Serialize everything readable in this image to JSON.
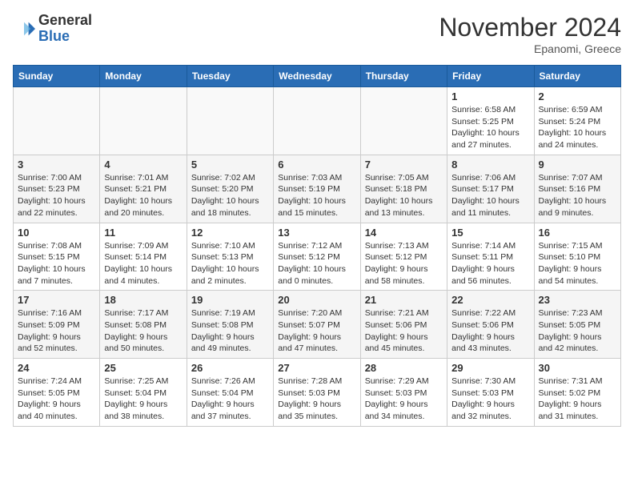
{
  "header": {
    "logo_line1": "General",
    "logo_line2": "Blue",
    "month": "November 2024",
    "location": "Epanomi, Greece"
  },
  "days_of_week": [
    "Sunday",
    "Monday",
    "Tuesday",
    "Wednesday",
    "Thursday",
    "Friday",
    "Saturday"
  ],
  "weeks": [
    [
      {
        "day": "",
        "info": ""
      },
      {
        "day": "",
        "info": ""
      },
      {
        "day": "",
        "info": ""
      },
      {
        "day": "",
        "info": ""
      },
      {
        "day": "",
        "info": ""
      },
      {
        "day": "1",
        "info": "Sunrise: 6:58 AM\nSunset: 5:25 PM\nDaylight: 10 hours\nand 27 minutes."
      },
      {
        "day": "2",
        "info": "Sunrise: 6:59 AM\nSunset: 5:24 PM\nDaylight: 10 hours\nand 24 minutes."
      }
    ],
    [
      {
        "day": "3",
        "info": "Sunrise: 7:00 AM\nSunset: 5:23 PM\nDaylight: 10 hours\nand 22 minutes."
      },
      {
        "day": "4",
        "info": "Sunrise: 7:01 AM\nSunset: 5:21 PM\nDaylight: 10 hours\nand 20 minutes."
      },
      {
        "day": "5",
        "info": "Sunrise: 7:02 AM\nSunset: 5:20 PM\nDaylight: 10 hours\nand 18 minutes."
      },
      {
        "day": "6",
        "info": "Sunrise: 7:03 AM\nSunset: 5:19 PM\nDaylight: 10 hours\nand 15 minutes."
      },
      {
        "day": "7",
        "info": "Sunrise: 7:05 AM\nSunset: 5:18 PM\nDaylight: 10 hours\nand 13 minutes."
      },
      {
        "day": "8",
        "info": "Sunrise: 7:06 AM\nSunset: 5:17 PM\nDaylight: 10 hours\nand 11 minutes."
      },
      {
        "day": "9",
        "info": "Sunrise: 7:07 AM\nSunset: 5:16 PM\nDaylight: 10 hours\nand 9 minutes."
      }
    ],
    [
      {
        "day": "10",
        "info": "Sunrise: 7:08 AM\nSunset: 5:15 PM\nDaylight: 10 hours\nand 7 minutes."
      },
      {
        "day": "11",
        "info": "Sunrise: 7:09 AM\nSunset: 5:14 PM\nDaylight: 10 hours\nand 4 minutes."
      },
      {
        "day": "12",
        "info": "Sunrise: 7:10 AM\nSunset: 5:13 PM\nDaylight: 10 hours\nand 2 minutes."
      },
      {
        "day": "13",
        "info": "Sunrise: 7:12 AM\nSunset: 5:12 PM\nDaylight: 10 hours\nand 0 minutes."
      },
      {
        "day": "14",
        "info": "Sunrise: 7:13 AM\nSunset: 5:12 PM\nDaylight: 9 hours\nand 58 minutes."
      },
      {
        "day": "15",
        "info": "Sunrise: 7:14 AM\nSunset: 5:11 PM\nDaylight: 9 hours\nand 56 minutes."
      },
      {
        "day": "16",
        "info": "Sunrise: 7:15 AM\nSunset: 5:10 PM\nDaylight: 9 hours\nand 54 minutes."
      }
    ],
    [
      {
        "day": "17",
        "info": "Sunrise: 7:16 AM\nSunset: 5:09 PM\nDaylight: 9 hours\nand 52 minutes."
      },
      {
        "day": "18",
        "info": "Sunrise: 7:17 AM\nSunset: 5:08 PM\nDaylight: 9 hours\nand 50 minutes."
      },
      {
        "day": "19",
        "info": "Sunrise: 7:19 AM\nSunset: 5:08 PM\nDaylight: 9 hours\nand 49 minutes."
      },
      {
        "day": "20",
        "info": "Sunrise: 7:20 AM\nSunset: 5:07 PM\nDaylight: 9 hours\nand 47 minutes."
      },
      {
        "day": "21",
        "info": "Sunrise: 7:21 AM\nSunset: 5:06 PM\nDaylight: 9 hours\nand 45 minutes."
      },
      {
        "day": "22",
        "info": "Sunrise: 7:22 AM\nSunset: 5:06 PM\nDaylight: 9 hours\nand 43 minutes."
      },
      {
        "day": "23",
        "info": "Sunrise: 7:23 AM\nSunset: 5:05 PM\nDaylight: 9 hours\nand 42 minutes."
      }
    ],
    [
      {
        "day": "24",
        "info": "Sunrise: 7:24 AM\nSunset: 5:05 PM\nDaylight: 9 hours\nand 40 minutes."
      },
      {
        "day": "25",
        "info": "Sunrise: 7:25 AM\nSunset: 5:04 PM\nDaylight: 9 hours\nand 38 minutes."
      },
      {
        "day": "26",
        "info": "Sunrise: 7:26 AM\nSunset: 5:04 PM\nDaylight: 9 hours\nand 37 minutes."
      },
      {
        "day": "27",
        "info": "Sunrise: 7:28 AM\nSunset: 5:03 PM\nDaylight: 9 hours\nand 35 minutes."
      },
      {
        "day": "28",
        "info": "Sunrise: 7:29 AM\nSunset: 5:03 PM\nDaylight: 9 hours\nand 34 minutes."
      },
      {
        "day": "29",
        "info": "Sunrise: 7:30 AM\nSunset: 5:03 PM\nDaylight: 9 hours\nand 32 minutes."
      },
      {
        "day": "30",
        "info": "Sunrise: 7:31 AM\nSunset: 5:02 PM\nDaylight: 9 hours\nand 31 minutes."
      }
    ]
  ]
}
